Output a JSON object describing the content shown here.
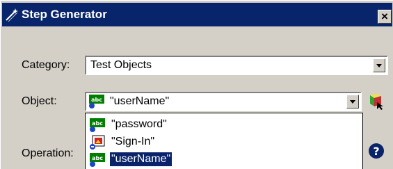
{
  "window": {
    "title": "Step Generator",
    "close_glyph": "×"
  },
  "form": {
    "category": {
      "label": "Category:",
      "value": "Test Objects"
    },
    "object": {
      "label": "Object:",
      "value": "\"userName\""
    },
    "operation": {
      "label": "Operation:"
    }
  },
  "object_dropdown": {
    "items": [
      {
        "label": "\"password\"",
        "icon": "edit-box-icon",
        "selected": false
      },
      {
        "label": "\"Sign-In\"",
        "icon": "image-icon",
        "selected": false
      },
      {
        "label": "\"userName\"",
        "icon": "edit-box-icon",
        "selected": true
      }
    ]
  },
  "icons": {
    "title": "step-generator-wand-icon",
    "object_selector": "object-repository-icon",
    "help": "help-icon"
  },
  "colors": {
    "titlebar": "#08246b",
    "selection": "#0a246a",
    "dialog": "#d4d0c8"
  }
}
